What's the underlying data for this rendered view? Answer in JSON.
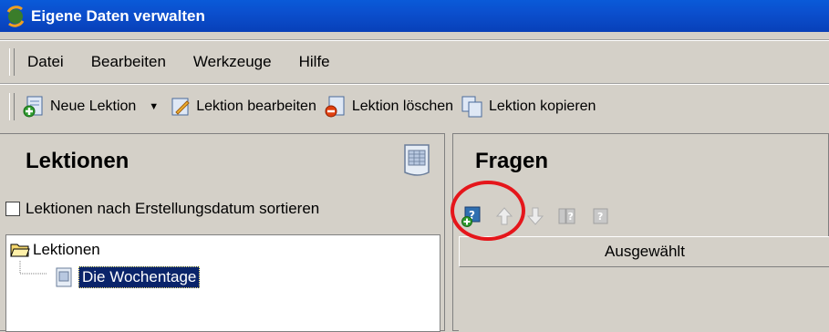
{
  "window": {
    "title": "Eigene Daten verwalten"
  },
  "menu": [
    "Datei",
    "Bearbeiten",
    "Werkzeuge",
    "Hilfe"
  ],
  "toolbar": {
    "new_lesson": "Neue Lektion",
    "edit_lesson": "Lektion bearbeiten",
    "delete_lesson": "Lektion löschen",
    "copy_lesson": "Lektion kopieren"
  },
  "lessons_panel": {
    "title": "Lektionen",
    "sort_checkbox_label": "Lektionen nach Erstellungsdatum sortieren",
    "sort_checked": false,
    "tree": {
      "root": "Lektionen",
      "items": [
        "Die Wochentage"
      ]
    }
  },
  "questions_panel": {
    "title": "Fragen",
    "column_header": "Ausgewählt",
    "toolbar_icons": [
      "add-question-icon",
      "move-up-icon",
      "move-down-icon",
      "question-icon",
      "question-edit-icon"
    ]
  },
  "colors": {
    "title_bar": "#0a5ad8",
    "selection": "#0a246a",
    "highlight_circle": "#e5161b"
  }
}
